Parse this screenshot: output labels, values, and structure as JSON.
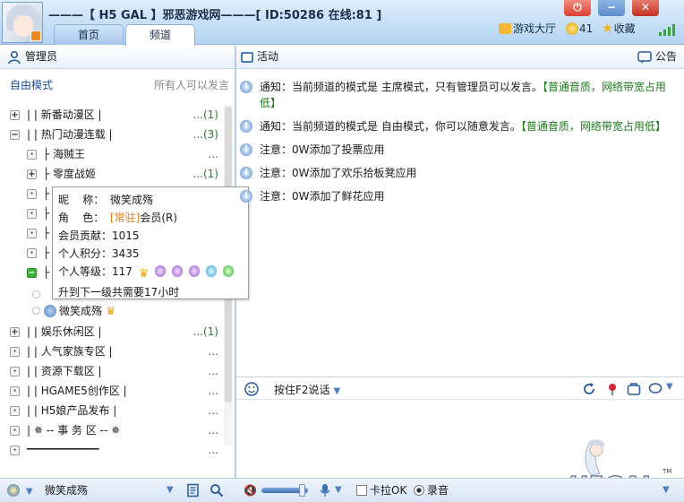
{
  "window": {
    "title": "———【 H5 GAL 】邪恶游戏网———[ ID:50286 在线:81 ]",
    "tabs": [
      "首页",
      "频道"
    ]
  },
  "topright": {
    "hall": "游戏大厅",
    "coins": "41",
    "favorites": "收藏"
  },
  "left_header": {
    "title": "管理员"
  },
  "right_header": {
    "title": "活动",
    "notice": "公告"
  },
  "modebar": {
    "mode": "自由模式",
    "hint": "所有人可以发言"
  },
  "tree": {
    "rows": [
      {
        "icon": "+",
        "text": "|        |  新番动漫区  |",
        "count": "...(1)"
      },
      {
        "icon": "−",
        "text": "|        |  热门动漫连载  |",
        "count": "...(3)"
      },
      {
        "icon": "·",
        "text": "├              海贼王",
        "count": "..."
      },
      {
        "icon": "+",
        "text": "├            零度战姬",
        "count": "...(1)"
      },
      {
        "icon": "·",
        "text": "├",
        "count": ""
      },
      {
        "icon": "·",
        "text": "├",
        "count": ""
      },
      {
        "icon": "·",
        "text": "├",
        "count": ""
      },
      {
        "icon": "·",
        "text": "├",
        "count": ""
      },
      {
        "icon": "−",
        "text": "├",
        "count": ""
      }
    ],
    "users": [
      "微笑成殇"
    ],
    "rows2": [
      {
        "icon": "+",
        "text": "|        |  娱乐休闲区  |",
        "count": "...(1)"
      },
      {
        "icon": "·",
        "text": "|        |  人气家族专区  |",
        "count": "..."
      },
      {
        "icon": "·",
        "text": "|        |  资源下载区  |",
        "count": "..."
      },
      {
        "icon": "·",
        "text": "|        |  HGAME5创作区  |",
        "count": "..."
      },
      {
        "icon": "·",
        "text": "|        |  H5娘产品发布  |",
        "count": "..."
      },
      {
        "icon": "·",
        "text": "|       ✵ -- 事 务 区 --  ✵",
        "count": "..."
      },
      {
        "icon": "·",
        "text": "━━━━━━━━━━━━━━━━━━",
        "count": "..."
      }
    ]
  },
  "tooltip": {
    "nick_label": "昵    称：",
    "nick": "微笑成殇",
    "role_label": "角    色：",
    "role_tag": "[常驻]",
    "role": "会员(R)",
    "contrib": "会员贡献：1015",
    "points": "个人积分：3435",
    "level": "个人等级：117",
    "next": "升到下一级共需要17小时"
  },
  "messages": [
    {
      "icon": "!",
      "prefix": "通知：当前频道的模式是 主席模式，只有管理员可以发言。",
      "suffix": "【普通音质，网络带宽占用低】"
    },
    {
      "icon": "!",
      "prefix": "通知：当前频道的模式是 自由模式，你可以随意发言。",
      "suffix": "【普通音质，网络带宽占用低】"
    },
    {
      "icon": "i",
      "prefix": "注意：0W添加了投票应用",
      "suffix": ""
    },
    {
      "icon": "i",
      "prefix": "注意：0W添加了欢乐拾板凳应用",
      "suffix": ""
    },
    {
      "icon": "i",
      "prefix": "注意：0W添加了鲜花应用",
      "suffix": ""
    }
  ],
  "inbar": {
    "label": "按住F2说话"
  },
  "bottombar": {
    "user": "微笑成殇",
    "karaoke": "卡拉OK",
    "record": "录音"
  },
  "logo": {
    "text": "H5GAL",
    "tm": "TM"
  },
  "colors": {
    "accent": "#1d4e99",
    "panel_bg": "#c4def7",
    "green": "#3cb23a",
    "orange": "#e07c12"
  }
}
